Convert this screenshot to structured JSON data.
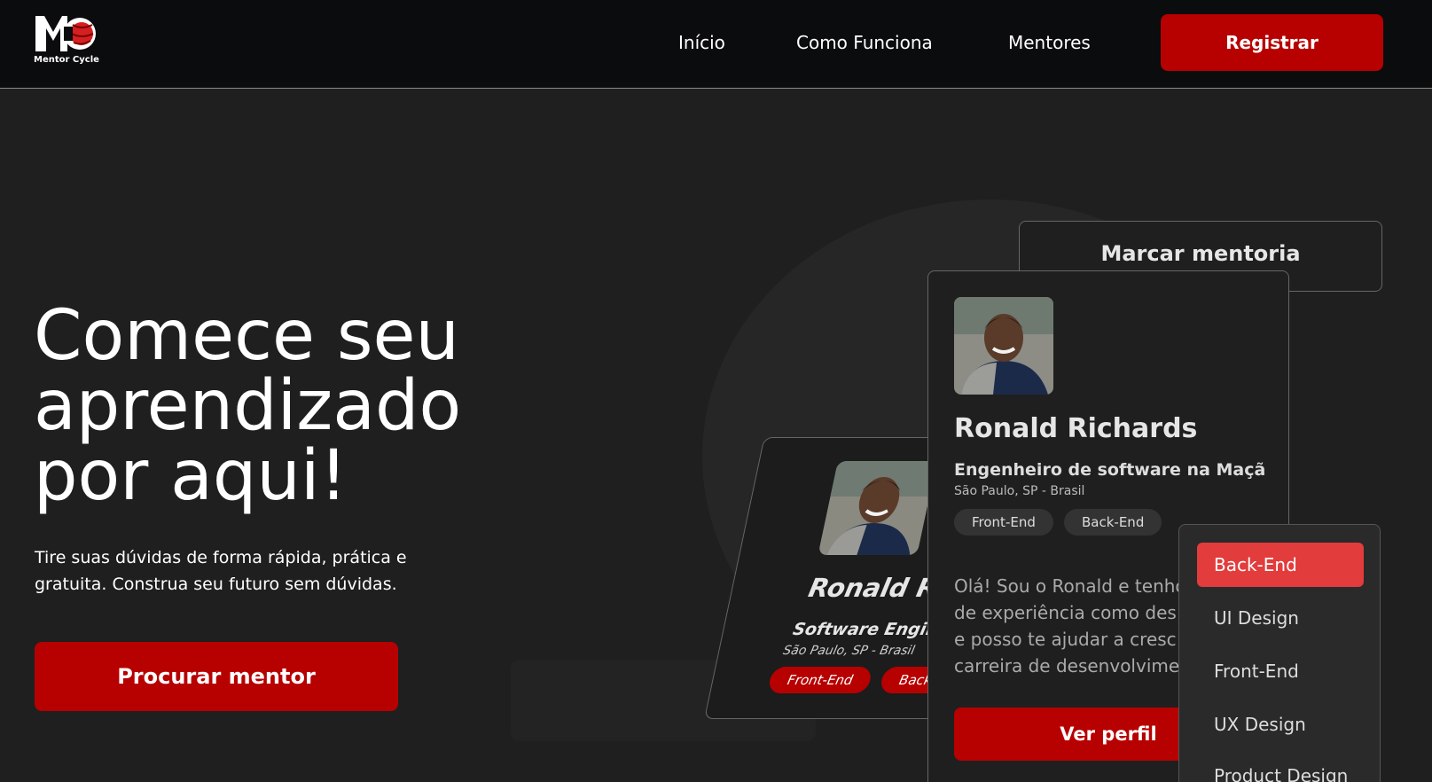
{
  "header": {
    "logo_text": "Mentor Cycle",
    "nav": [
      {
        "label": "Início"
      },
      {
        "label": "Como Funciona"
      },
      {
        "label": "Mentores"
      }
    ],
    "register_label": "Registrar"
  },
  "hero": {
    "title_line1": "Comece seu",
    "title_line2": "aprendizado",
    "title_line3": "por aqui!",
    "subtitle_line1": "Tire suas dúvidas de forma rápida, prática e",
    "subtitle_line2": "gratuita. Construa seu futuro sem dúvidas.",
    "cta_label": "Procurar mentor"
  },
  "book_card": {
    "title": "Marcar mentoria"
  },
  "back_card": {
    "name": "Ronald Rich",
    "role": "Software Engineer",
    "location": "São Paulo, SP - Brasil",
    "tags": [
      "Front-End",
      "Back-En"
    ]
  },
  "profile_card": {
    "name": "Ronald Richards",
    "role": "Engenheiro de software na Maçã",
    "location": "São Paulo, SP - Brasil",
    "tags": [
      "Front-End",
      "Back-End"
    ],
    "bio_lines": [
      "Olá! Sou o Ronald e tenho",
      "de experiência como des",
      "e posso te ajudar a cresc",
      "carreira de desenvolvime"
    ],
    "button_label": "Ver perfil"
  },
  "dropdown": {
    "items": [
      "Back-End",
      "UI Design",
      "Front-End",
      "UX Design",
      "Product Design"
    ],
    "selected": "Back-End"
  },
  "colors": {
    "brand_red": "#b70000",
    "dropdown_active": "#e23c3c",
    "background": "#1f1f1f",
    "header_bg": "#0b0c0e"
  }
}
